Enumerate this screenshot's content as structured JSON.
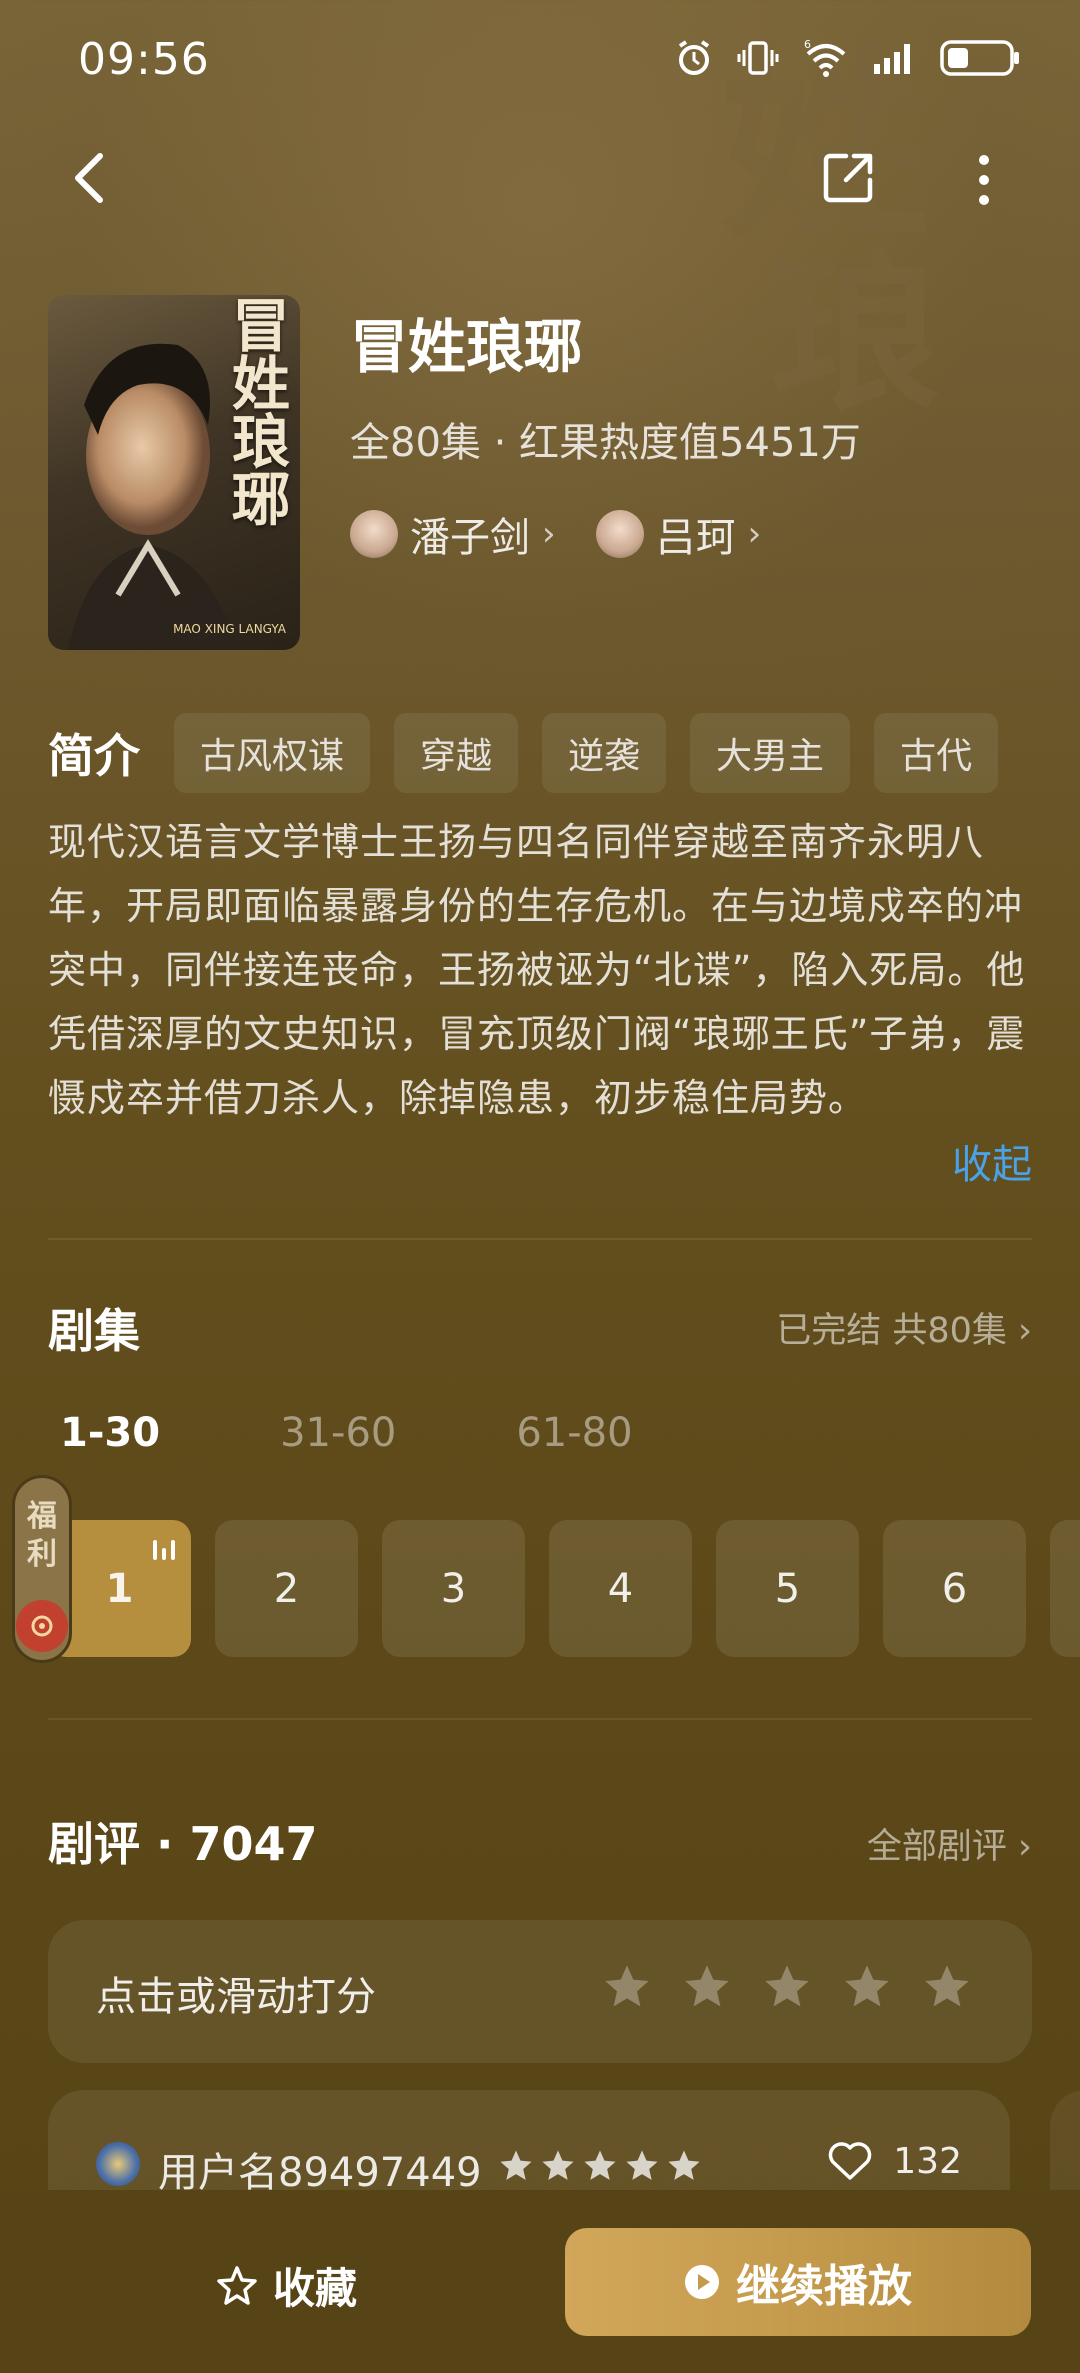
{
  "status_bar": {
    "time": "09:56"
  },
  "drama": {
    "title": "冒姓琅琊",
    "meta": "全80集 · 红果热度值5451万",
    "actors": [
      {
        "name": "潘子剑"
      },
      {
        "name": "吕珂"
      }
    ],
    "poster_title": "冒姓琅琊",
    "poster_subtitle": "MAO XING LANGYA"
  },
  "intro": {
    "label": "简介",
    "tags": [
      "古风权谋",
      "穿越",
      "逆袭",
      "大男主",
      "古代"
    ],
    "synopsis": "现代汉语言文学博士王扬与四名同伴穿越至南齐永明八年，开局即面临暴露身份的生存危机。在与边境戍卒的冲突中，同伴接连丧命，王扬被诬为“北谍”，陷入死局。他凭借深厚的文史知识，冒充顶级门阀“琅琊王氏”子弟，震慑戍卒并借刀杀人，除掉隐患，初步稳住局势。",
    "collapse_label": "收起"
  },
  "episodes": {
    "label": "剧集",
    "status": "已完结 共80集",
    "ranges": [
      "1-30",
      "31-60",
      "61-80"
    ],
    "active_range": 0,
    "items": [
      "1",
      "2",
      "3",
      "4",
      "5",
      "6"
    ],
    "active_episode": "1"
  },
  "welfare": {
    "label_1": "福",
    "label_2": "利"
  },
  "reviews": {
    "label": "剧评 · 7047",
    "all_link": "全部剧评",
    "rate_prompt": "点击或滑动打分",
    "rate_star_count": 5,
    "first": {
      "username": "用户名89497449",
      "rating": 5,
      "likes": "132"
    }
  },
  "bottom_bar": {
    "favorite_label": "收藏",
    "play_label": "继续播放"
  },
  "colors": {
    "accent_link": "#4aa3e8",
    "active_episode": "#b58e3e",
    "play_button": "#c49a4c"
  }
}
